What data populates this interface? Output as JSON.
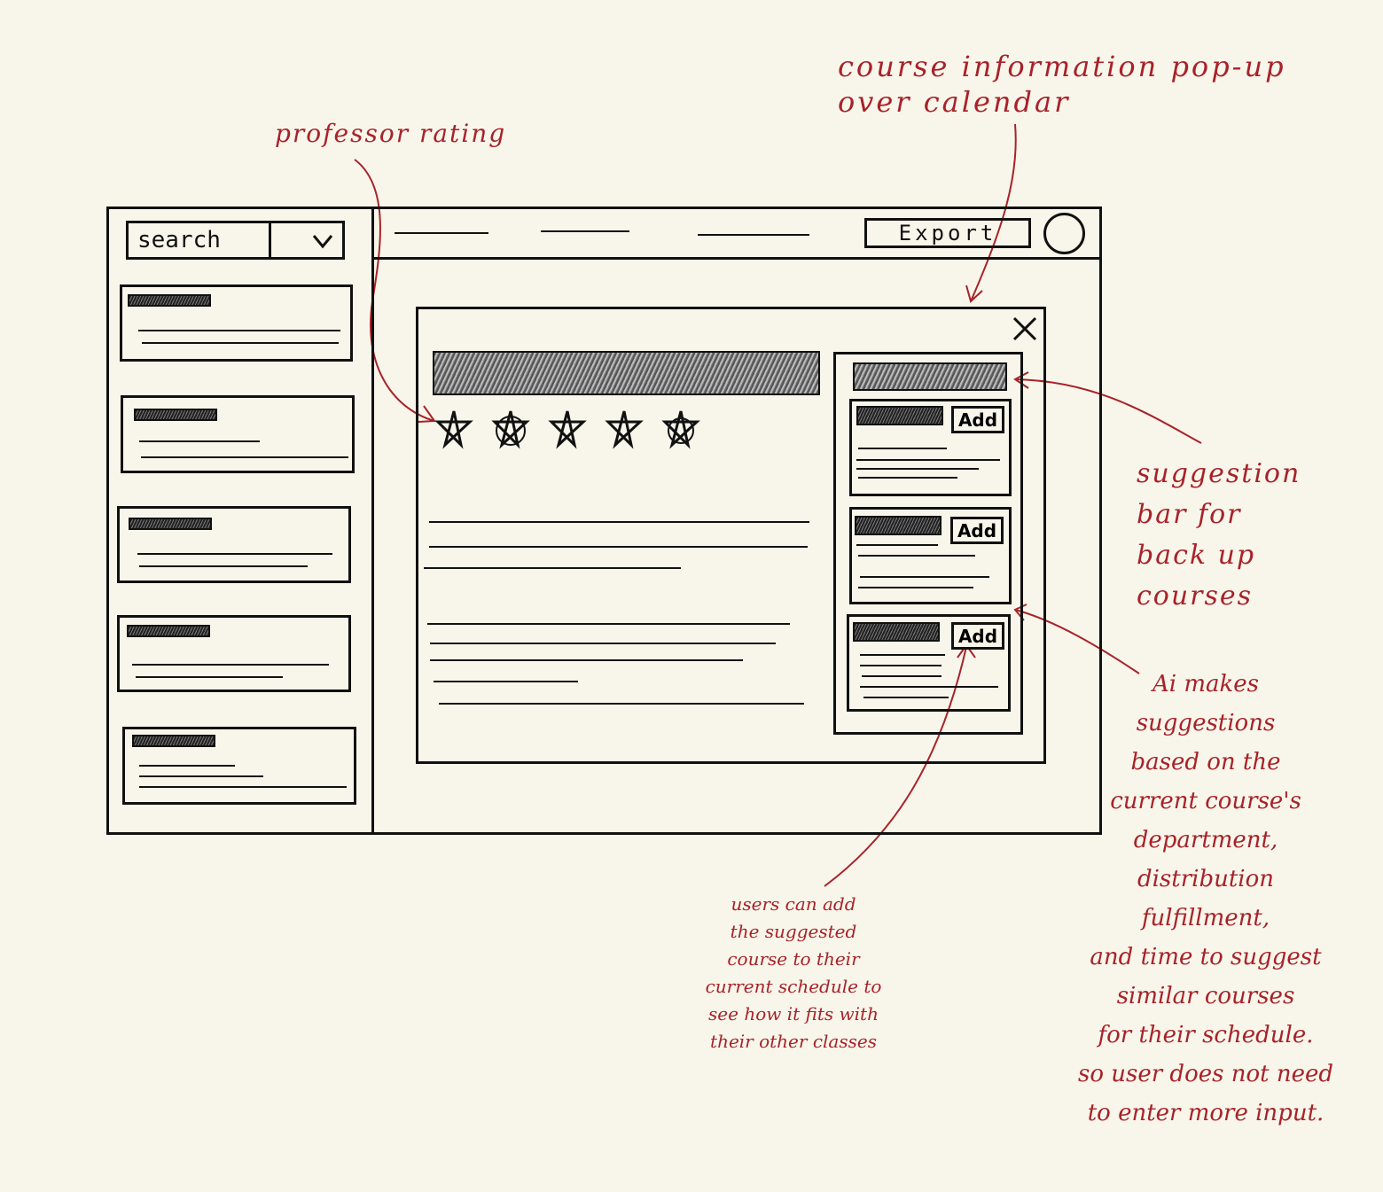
{
  "app": {
    "search_placeholder": "search",
    "export_label": "Export",
    "close_symbol": "✕",
    "dropdown_symbol": "⌄",
    "suggestions": [
      {
        "add_label": "Add"
      },
      {
        "add_label": "Add"
      },
      {
        "add_label": "Add"
      }
    ],
    "rating": {
      "stars": 5,
      "symbol": "✯"
    }
  },
  "annotations": {
    "popup": "course information pop-up\nover calendar",
    "rating": "professor rating",
    "suggestion_bar": "suggestion\nbar for\nback up\ncourses",
    "ai": "Ai makes\nsuggestions\nbased on the\ncurrent course's\ndepartment,\ndistribution\nfulfillment,\nand time to suggest\nsimilar courses\nfor their schedule.\nso user does not need\nto enter more input.",
    "add": "users can add\nthe suggested\ncourse to their\ncurrent schedule to\nsee how it fits with\ntheir other classes"
  },
  "colors": {
    "background": "#f8f6ea",
    "ink": "#111111",
    "annotation": "#a8222a"
  }
}
